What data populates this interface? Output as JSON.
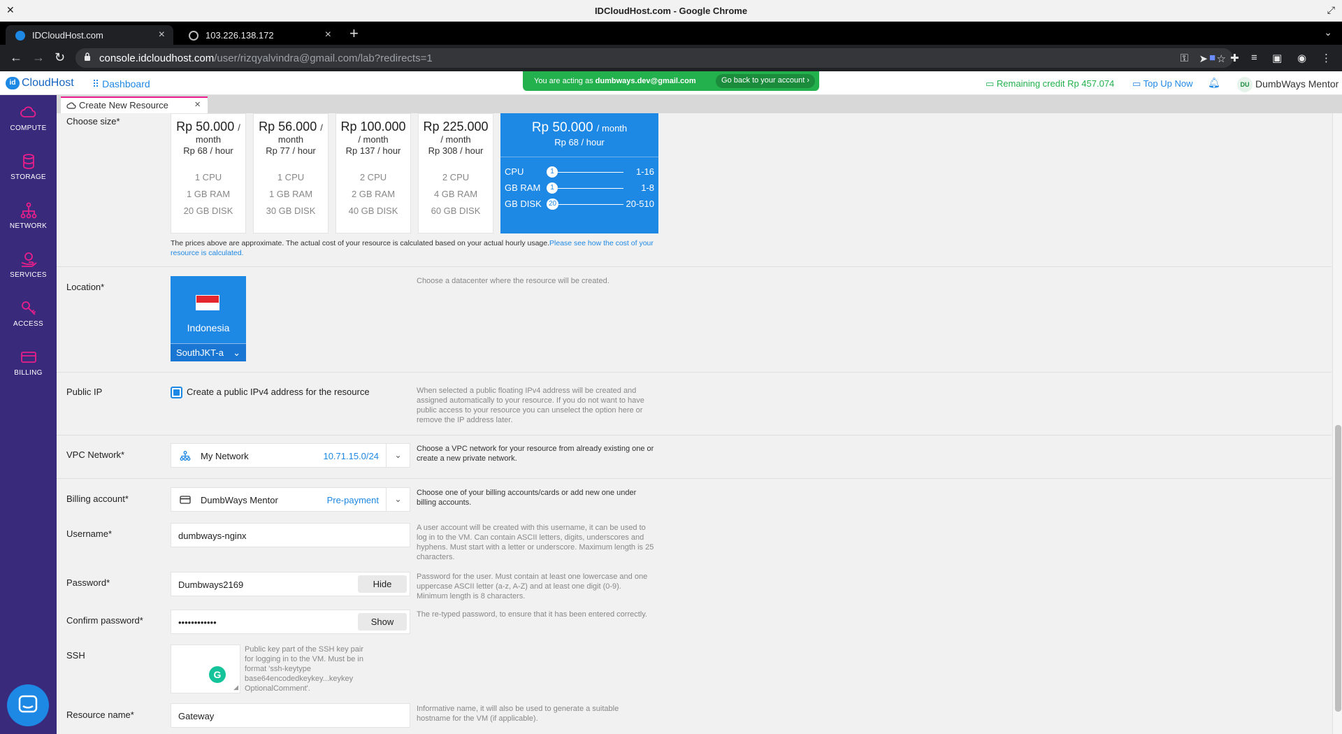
{
  "browser": {
    "window_title": "IDCloudHost.com - Google Chrome",
    "tabs": [
      {
        "label": "IDCloudHost.com"
      },
      {
        "label": "103.226.138.172"
      }
    ],
    "url_host": "console.idcloudhost.com",
    "url_path": "/user/rizqyalvindra@gmail.com/lab?redirects=1"
  },
  "header": {
    "logo_badge": "id",
    "logo_text": "CloudHost",
    "dashboard_label": "Dashboard",
    "acting_prefix": "You are acting as",
    "acting_email": "dumbways.dev@gmail.com",
    "go_back_label": "Go back to your account ›",
    "credit_label": "Remaining credit Rp 457.074",
    "topup_label": "Top Up Now",
    "user_initials": "DU",
    "user_name": "DumbWays Mentor"
  },
  "sidebar": {
    "items": [
      {
        "label": "COMPUTE",
        "icon": "cloud-icon"
      },
      {
        "label": "STORAGE",
        "icon": "database-icon"
      },
      {
        "label": "NETWORK",
        "icon": "network-icon"
      },
      {
        "label": "SERVICES",
        "icon": "services-icon"
      },
      {
        "label": "ACCESS",
        "icon": "key-icon"
      },
      {
        "label": "BILLING",
        "icon": "card-icon"
      }
    ],
    "accent": "#e91e8a",
    "bg": "#3a2a7c"
  },
  "content_tab": {
    "label": "Create New Resource"
  },
  "form": {
    "size": {
      "label": "Choose size*",
      "cards": [
        {
          "price": "Rp 50.000",
          "per": "/",
          "per2": "month",
          "hour": "Rp 68 / hour",
          "cpu": "1 CPU",
          "ram": "1 GB RAM",
          "disk": "20 GB DISK"
        },
        {
          "price": "Rp 56.000",
          "per": "/",
          "per2": "month",
          "hour": "Rp 77 / hour",
          "cpu": "1 CPU",
          "ram": "1 GB RAM",
          "disk": "30 GB DISK"
        },
        {
          "price": "Rp 100.000",
          "per": "",
          "per2": "/ month",
          "hour": "Rp 137 / hour",
          "cpu": "2 CPU",
          "ram": "2 GB RAM",
          "disk": "40 GB DISK"
        },
        {
          "price": "Rp 225.000",
          "per": "",
          "per2": "/ month",
          "hour": "Rp 308 / hour",
          "cpu": "2 CPU",
          "ram": "4 GB RAM",
          "disk": "60 GB DISK"
        }
      ],
      "custom": {
        "price": "Rp 50.000",
        "per": "/ month",
        "hour": "Rp 68 / hour",
        "sliders": [
          {
            "label": "CPU",
            "value": "1",
            "range": "1-16"
          },
          {
            "label": "GB RAM",
            "value": "1",
            "range": "1-8"
          },
          {
            "label": "GB DISK",
            "value": "20",
            "range": "20-510"
          }
        ]
      },
      "note": "The prices above are approximate. The actual cost of your resource is calculated based on your actual hourly usage.",
      "note_link": "Please see how the cost of your resource is calculated."
    },
    "location": {
      "label": "Location*",
      "help": "Choose a datacenter where the resource will be created.",
      "country": "Indonesia",
      "zone": "SouthJKT-a"
    },
    "public_ip": {
      "label": "Public IP",
      "checkbox_label": "Create a public IPv4 address for the resource",
      "checked": true,
      "help": "When selected a public floating IPv4 address will be created and assigned automatically to your resource. If you do not want to have public access to your resource you can unselect the option here or remove the IP address later."
    },
    "vpc": {
      "label": "VPC Network*",
      "value": "My Network",
      "subnet": "10.71.15.0/24",
      "help": "Choose a VPC network for your resource from already existing one or create a new private network."
    },
    "billing": {
      "label": "Billing account*",
      "value": "DumbWays Mentor",
      "type": "Pre-payment",
      "help": "Choose one of your billing accounts/cards or add new one under billing accounts."
    },
    "username": {
      "label": "Username*",
      "value": "dumbways-nginx",
      "help": "A user account will be created with this username, it can be used to log in to the VM. Can contain ASCII letters, digits, underscores and hyphens. Must start with a letter or underscore. Maximum length is 25 characters."
    },
    "password": {
      "label": "Password*",
      "value": "Dumbways2169",
      "toggle_label": "Hide",
      "help": "Password for the user. Must contain at least one lowercase and one uppercase ASCII letter (a-z, A-Z) and at least one digit (0-9). Minimum length is 8 characters."
    },
    "confirm_password": {
      "label": "Confirm password*",
      "value": "••••••••••••",
      "toggle_label": "Show",
      "help": "The re-typed password, to ensure that it has been entered correctly."
    },
    "ssh": {
      "label": "SSH",
      "help": "Public key part of the SSH key pair for logging in to the VM. Must be in format 'ssh-keytype base64encodedkeykey...keykey OptionalComment'."
    },
    "resource_name": {
      "label": "Resource name*",
      "value": "Gateway",
      "help": "Informative name, it will also be used to generate a suitable hostname for the VM (if applicable)."
    }
  }
}
